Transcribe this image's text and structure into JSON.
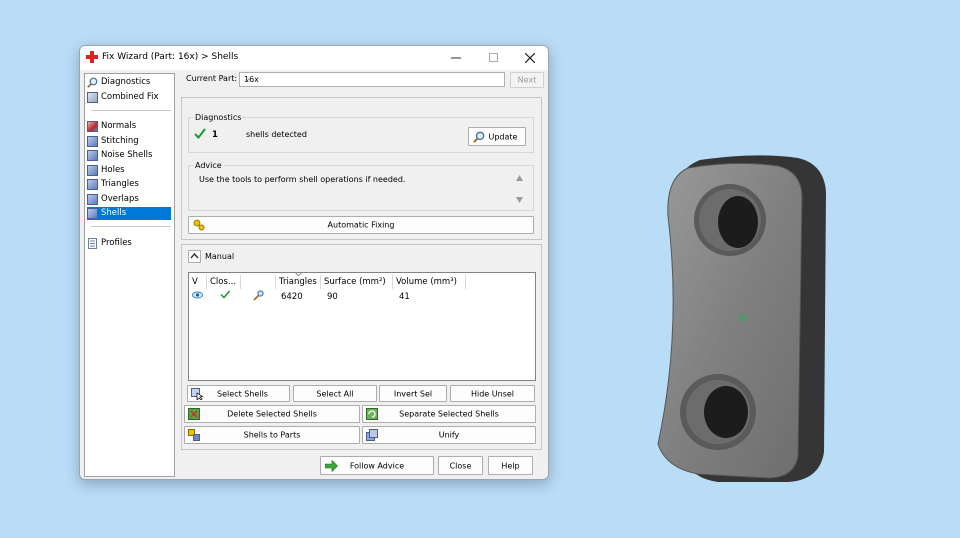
{
  "window": {
    "title": "Fix Wizard (Part: 16x) > Shells",
    "minimize_icon": "minimize-icon",
    "maximize_icon": "maximize-icon",
    "close_icon": "close-icon"
  },
  "sidebar": {
    "items": [
      {
        "label": "Diagnostics",
        "icon": "magnifier-icon"
      },
      {
        "label": "Combined Fix",
        "icon": "cube-icon"
      },
      {
        "label": "Normals",
        "icon": "normals-icon"
      },
      {
        "label": "Stitching",
        "icon": "stitching-icon"
      },
      {
        "label": "Noise Shells",
        "icon": "noise-shells-icon"
      },
      {
        "label": "Holes",
        "icon": "holes-icon"
      },
      {
        "label": "Triangles",
        "icon": "triangles-icon"
      },
      {
        "label": "Overlaps",
        "icon": "overlaps-icon"
      },
      {
        "label": "Shells",
        "icon": "shells-icon",
        "selected": true
      },
      {
        "label": "Profiles",
        "icon": "profiles-icon"
      }
    ]
  },
  "part_selector": {
    "label": "Current Part:",
    "value": "16x",
    "next_label": "Next"
  },
  "diagnostics": {
    "title": "Diagnostics",
    "count": "1",
    "status_text": "shells detected",
    "update_label": "Update"
  },
  "advice": {
    "title": "Advice",
    "text": "Use the tools to perform shell operations if needed."
  },
  "automatic_fixing_label": "Automatic Fixing",
  "manual": {
    "title": "Manual",
    "columns": [
      "V",
      "Clos...",
      "",
      "Triangles",
      "Surface (mm²)",
      "Volume (mm³)"
    ],
    "rows": [
      {
        "visible_icon": "eye-icon",
        "closed_icon": "checkmark-icon",
        "tool_icon": "wrench-icon",
        "triangles": "6420",
        "surface": "90",
        "volume": "41"
      }
    ],
    "buttons": {
      "select_shells": "Select Shells",
      "select_all": "Select All",
      "invert_sel": "Invert Sel",
      "hide_unsel": "Hide Unsel",
      "delete_selected": "Delete Selected Shells",
      "separate_selected": "Separate Selected Shells",
      "shells_to_parts": "Shells to Parts",
      "unify": "Unify"
    }
  },
  "footer": {
    "follow_advice": "Follow Advice",
    "close": "Close",
    "help": "Help"
  },
  "colors": {
    "background": "#b9dcf7",
    "selection": "#0078d7",
    "check_green": "#1a9a2a",
    "part_gray": "#7d7d7d"
  }
}
